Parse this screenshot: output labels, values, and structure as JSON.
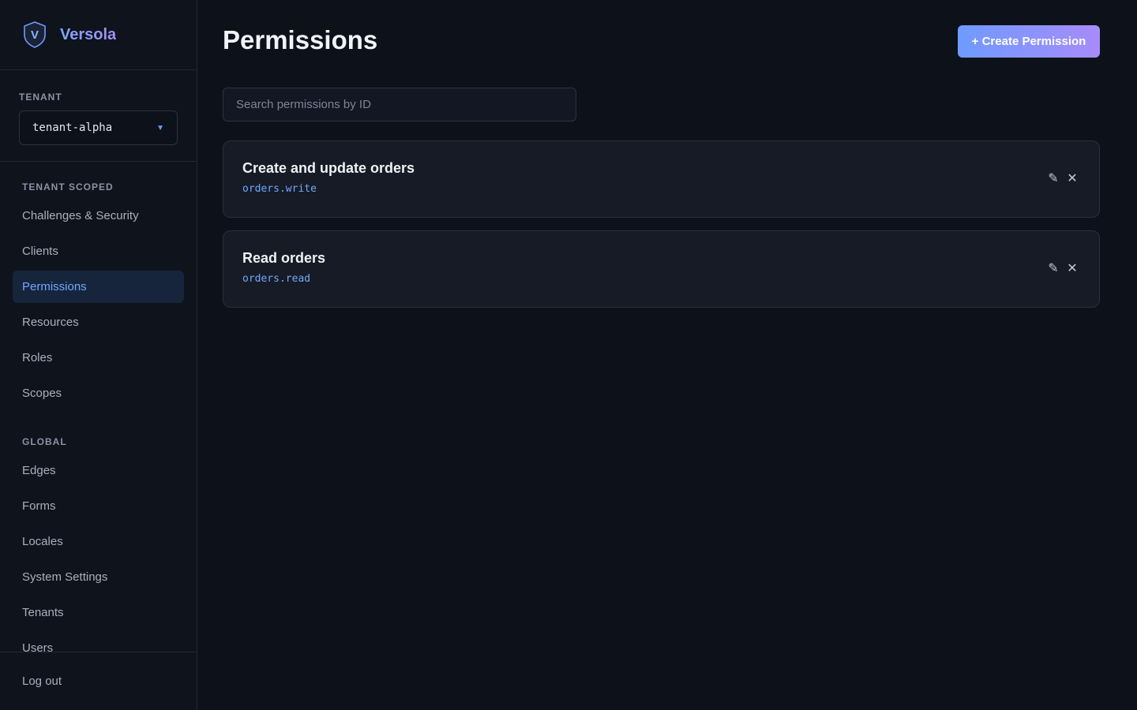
{
  "brand": {
    "logo_letter": "V",
    "name": "Versola"
  },
  "tenant": {
    "label": "TENANT",
    "selected": "tenant-alpha"
  },
  "nav": {
    "tenant_scoped_label": "TENANT SCOPED",
    "tenant_scoped_items": [
      {
        "label": "Challenges & Security"
      },
      {
        "label": "Clients"
      },
      {
        "label": "Permissions",
        "active": true
      },
      {
        "label": "Resources"
      },
      {
        "label": "Roles"
      },
      {
        "label": "Scopes"
      }
    ],
    "global_label": "GLOBAL",
    "global_items": [
      {
        "label": "Edges"
      },
      {
        "label": "Forms"
      },
      {
        "label": "Locales"
      },
      {
        "label": "System Settings"
      },
      {
        "label": "Tenants"
      },
      {
        "label": "Users"
      }
    ],
    "logout_label": "Log out"
  },
  "page": {
    "title": "Permissions",
    "create_label": "+ Create Permission",
    "search_placeholder": "Search permissions by ID"
  },
  "permissions": [
    {
      "name": "Create and update orders",
      "id": "orders.write"
    },
    {
      "name": "Read orders",
      "id": "orders.read"
    }
  ],
  "icons": {
    "edit": "pencil-icon",
    "delete": "close-icon",
    "dropdown": "caret-down-icon",
    "logo": "shield-icon"
  },
  "colors": {
    "accent": "#6fa8ff",
    "accent_gradient_end": "#a78bfa",
    "background": "#0d1119"
  }
}
